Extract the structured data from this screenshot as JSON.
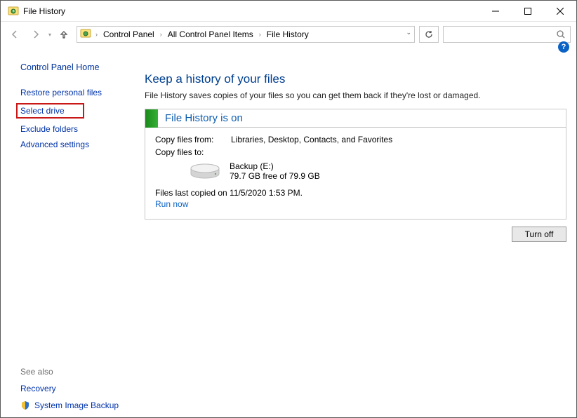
{
  "window": {
    "title": "File History"
  },
  "breadcrumbs": {
    "a": "Control Panel",
    "b": "All Control Panel Items",
    "c": "File History"
  },
  "sidebar": {
    "home": "Control Panel Home",
    "items": {
      "restore": "Restore personal files",
      "select": "Select drive",
      "exclude": "Exclude folders",
      "advanced": "Advanced settings"
    },
    "seealso": "See also",
    "recovery": "Recovery",
    "system_image": "System Image Backup"
  },
  "main": {
    "heading": "Keep a history of your files",
    "subheading": "File History saves copies of your files so you can get them back if they're lost or damaged.",
    "status_title": "File History is on",
    "copy_from_label": "Copy files from:",
    "copy_from_value": "Libraries, Desktop, Contacts, and Favorites",
    "copy_to_label": "Copy files to:",
    "drive_name": "Backup (E:)",
    "drive_free": "79.7 GB free of 79.9 GB",
    "last_copied": "Files last copied on 11/5/2020 1:53 PM.",
    "run_now": "Run now",
    "turn_off": "Turn off"
  }
}
